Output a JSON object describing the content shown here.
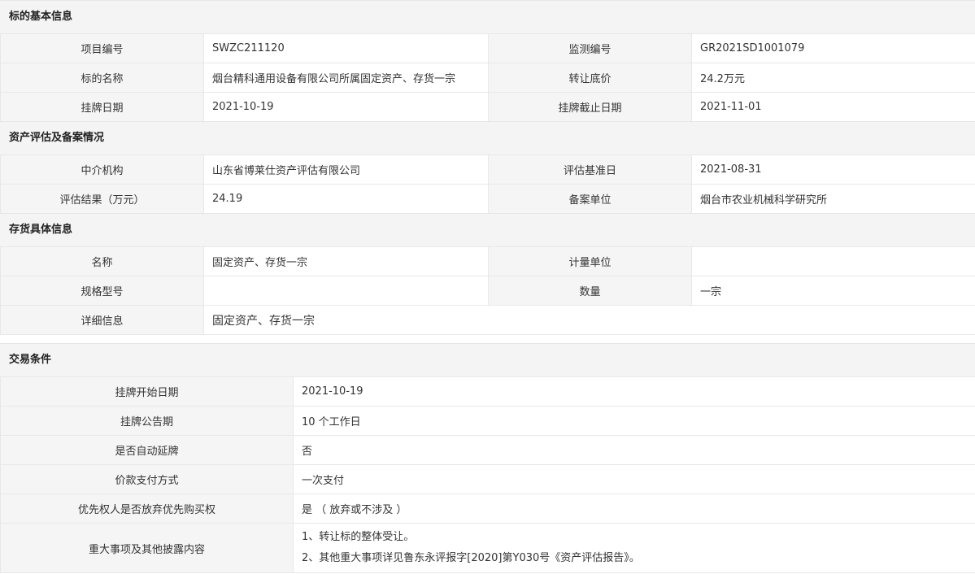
{
  "basic": {
    "title": "标的基本信息",
    "rows": [
      [
        "项目编号",
        "SWZC211120",
        "监测编号",
        "GR2021SD1001079"
      ],
      [
        "标的名称",
        "烟台精科通用设备有限公司所属固定资产、存货一宗",
        "转让底价",
        "24.2万元"
      ],
      [
        "挂牌日期",
        "2021-10-19",
        "挂牌截止日期",
        "2021-11-01"
      ]
    ]
  },
  "appraisal": {
    "title": "资产评估及备案情况",
    "rows": [
      [
        "中介机构",
        "山东省博莱仕资产评估有限公司",
        "评估基准日",
        "2021-08-31"
      ],
      [
        "评估结果（万元）",
        "24.19",
        "备案单位",
        "烟台市农业机械科学研究所"
      ]
    ]
  },
  "inventory": {
    "title": "存货具体信息",
    "rows": [
      [
        "名称",
        "固定资产、存货一宗",
        "计量单位",
        ""
      ],
      [
        "规格型号",
        "",
        "数量",
        "一宗"
      ]
    ],
    "detail_label": "详细信息",
    "detail_value": "固定资产、存货一宗"
  },
  "trade": {
    "title": "交易条件",
    "rows": [
      [
        "挂牌开始日期",
        "2021-10-19"
      ],
      [
        "挂牌公告期",
        "10 个工作日"
      ],
      [
        "是否自动延牌",
        "否"
      ],
      [
        "价款支付方式",
        "一次支付"
      ],
      [
        "优先权人是否放弃优先购买权",
        "是 （ 放弃或不涉及 ）"
      ]
    ],
    "disclosure_label": "重大事项及其他披露内容",
    "disclosure_lines": [
      "1、转让标的整体受让。",
      "2、其他重大事项详见鲁东永评报字[2020]第Y030号《资产评估报告》。"
    ]
  }
}
